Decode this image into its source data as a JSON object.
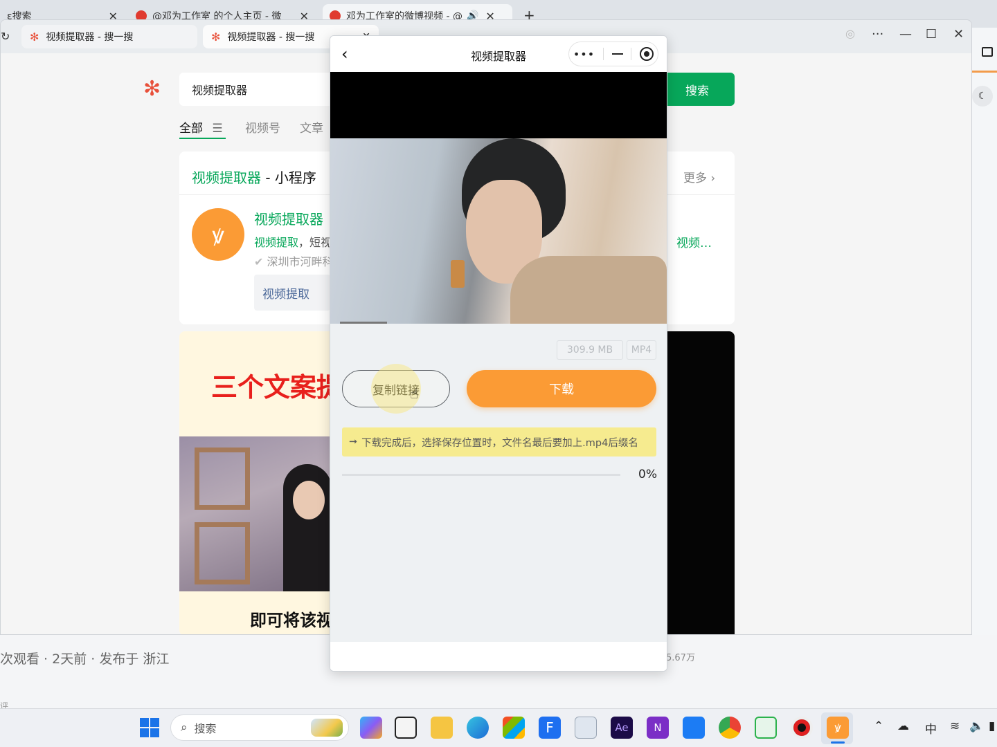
{
  "background_browser": {
    "tabs": [
      {
        "label": "ε搜索"
      },
      {
        "label": "@邓为工作室 的个人主页 - 微"
      },
      {
        "label": "邓为工作室的微博视频 - @"
      }
    ],
    "bottom_text": "次观看 · 2天前 · 发布于 浙江",
    "bottom_right_count": "5.67万",
    "bottom_left_small": "评"
  },
  "browser": {
    "tabs": [
      {
        "label": "视频提取器 - 搜一搜"
      },
      {
        "label": "视频提取器 - 搜一搜"
      }
    ],
    "window_controls": {
      "minimize": "—",
      "maximize": "☐",
      "close": "✕",
      "more": "···"
    }
  },
  "search_page": {
    "query": "视频提取器",
    "search_button": "搜索",
    "filter_tabs": [
      {
        "label": "全部"
      },
      {
        "label": "视频号"
      },
      {
        "label": "文章"
      }
    ],
    "mini_program_card": {
      "heading_highlight": "视频提取器",
      "heading_rest": " - 小程序",
      "more_label": "更多",
      "app_name": "视频提取器",
      "description_highlight": "视频提取",
      "description_rest": "，短视",
      "company": "深圳市河畔科",
      "service_chip": "视频提取",
      "right_snippet": "视频…"
    },
    "video_card": {
      "banner_text": "三个文案提",
      "caption_text": "即可将该视"
    }
  },
  "mini_program": {
    "title": "视频提取器",
    "back_icon": "chevron-left-icon",
    "file_size": "309.9 MB",
    "file_format": "MP4",
    "copy_link_button": "复制链接",
    "download_button": "下载",
    "tip_arrow": "➞",
    "tip_text": "下载完成后，选择保存位置时，文件名最后要加上.mp4后缀名",
    "progress_percent": "0%",
    "progress_value": 0,
    "accent_color": "#fb9b35"
  },
  "taskbar": {
    "search_placeholder": "搜索",
    "tray": {
      "ime": "中"
    }
  }
}
